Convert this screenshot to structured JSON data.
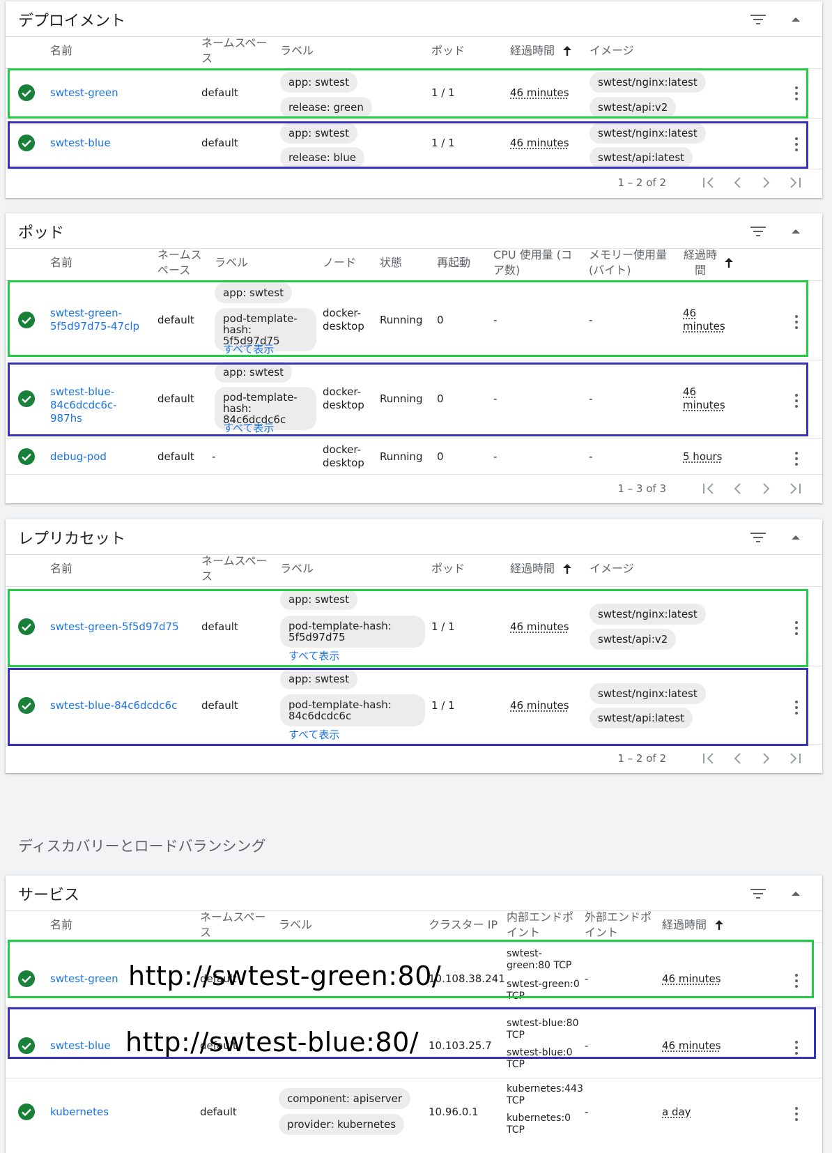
{
  "deployments": {
    "title": "デプロイメント",
    "headers": {
      "name": "名前",
      "namespace": "ネームスペース",
      "labels": "ラベル",
      "pods": "ポッド",
      "age": "経過時間",
      "images": "イメージ"
    },
    "rows": [
      {
        "name": "swtest-green",
        "namespace": "default",
        "labels": [
          "app: swtest",
          "release: green"
        ],
        "pods": "1 / 1",
        "age": "46 minutes",
        "images": [
          "swtest/nginx:latest",
          "swtest/api:v2"
        ]
      },
      {
        "name": "swtest-blue",
        "namespace": "default",
        "labels": [
          "app: swtest",
          "release: blue"
        ],
        "pods": "1 / 1",
        "age": "46 minutes",
        "images": [
          "swtest/nginx:latest",
          "swtest/api:latest"
        ]
      }
    ],
    "pagination": "1 – 2 of 2"
  },
  "pods": {
    "title": "ポッド",
    "headers": {
      "name": "名前",
      "namespace": "ネームスペース",
      "labels": "ラベル",
      "node": "ノード",
      "status": "状態",
      "restarts": "再起動",
      "cpu": "CPU 使用量 (コア数)",
      "memory": "メモリー使用量 (バイト)",
      "age": "経過時間"
    },
    "rows": [
      {
        "name": "swtest-green-5f5d97d75-47clp",
        "namespace": "default",
        "labels": [
          "app: swtest",
          "pod-template-hash: 5f5d97d75"
        ],
        "show_all": "すべて表示",
        "node": "docker-desktop",
        "status": "Running",
        "restarts": "0",
        "cpu": "-",
        "memory": "-",
        "age": "46 minutes"
      },
      {
        "name": "swtest-blue-84c6dcdc6c-987hs",
        "namespace": "default",
        "labels": [
          "app: swtest",
          "pod-template-hash: 84c6dcdc6c"
        ],
        "show_all": "すべて表示",
        "node": "docker-desktop",
        "status": "Running",
        "restarts": "0",
        "cpu": "-",
        "memory": "-",
        "age": "46 minutes"
      },
      {
        "name": "debug-pod",
        "namespace": "default",
        "labels_text": "-",
        "node": "docker-desktop",
        "status": "Running",
        "restarts": "0",
        "cpu": "-",
        "memory": "-",
        "age": "5 hours"
      }
    ],
    "pagination": "1 – 3 of 3"
  },
  "replicasets": {
    "title": "レプリカセット",
    "headers": {
      "name": "名前",
      "namespace": "ネームスペース",
      "labels": "ラベル",
      "pods": "ポッド",
      "age": "経過時間",
      "images": "イメージ"
    },
    "rows": [
      {
        "name": "swtest-green-5f5d97d75",
        "namespace": "default",
        "labels": [
          "app: swtest",
          "pod-template-hash: 5f5d97d75"
        ],
        "show_all": "すべて表示",
        "pods": "1 / 1",
        "age": "46 minutes",
        "images": [
          "swtest/nginx:latest",
          "swtest/api:v2"
        ]
      },
      {
        "name": "swtest-blue-84c6dcdc6c",
        "namespace": "default",
        "labels": [
          "app: swtest",
          "pod-template-hash: 84c6dcdc6c"
        ],
        "show_all": "すべて表示",
        "pods": "1 / 1",
        "age": "46 minutes",
        "images": [
          "swtest/nginx:latest",
          "swtest/api:latest"
        ]
      }
    ],
    "pagination": "1 – 2 of 2"
  },
  "discovery_heading": "ディスカバリーとロードバランシング",
  "services": {
    "title": "サービス",
    "headers": {
      "name": "名前",
      "namespace": "ネームスペース",
      "labels": "ラベル",
      "cluster_ip": "クラスター IP",
      "internal": "内部エンドポイント",
      "external": "外部エンドポイント",
      "age": "経過時間"
    },
    "rows": [
      {
        "name": "swtest-green",
        "namespace": "default",
        "cluster_ip": "10.108.38.241",
        "internal": [
          "swtest-green:80 TCP",
          "swtest-green:0 TCP"
        ],
        "external": "-",
        "age": "46 minutes",
        "overlay": "http://swtest-green:80/"
      },
      {
        "name": "swtest-blue",
        "namespace": "default",
        "cluster_ip": "10.103.25.7",
        "internal": [
          "swtest-blue:80 TCP",
          "swtest-blue:0 TCP"
        ],
        "external": "-",
        "age": "46 minutes",
        "overlay": "http://swtest-blue:80/"
      },
      {
        "name": "kubernetes",
        "namespace": "default",
        "labels": [
          "component: apiserver",
          "provider: kubernetes"
        ],
        "cluster_ip": "10.96.0.1",
        "internal": [
          "kubernetes:443 TCP",
          "kubernetes:0 TCP"
        ],
        "external": "-",
        "age": "a day"
      }
    ]
  },
  "colors": {
    "link": "#1a73e8",
    "ok": "#188038",
    "highlight_green": "#22cc44",
    "highlight_blue": "#3333bb"
  },
  "icons": {
    "filter": "filter-icon",
    "collapse": "chevron-up-icon",
    "sort": "arrow-up-icon",
    "more": "more-vert-icon",
    "status": "check-circle-icon"
  }
}
